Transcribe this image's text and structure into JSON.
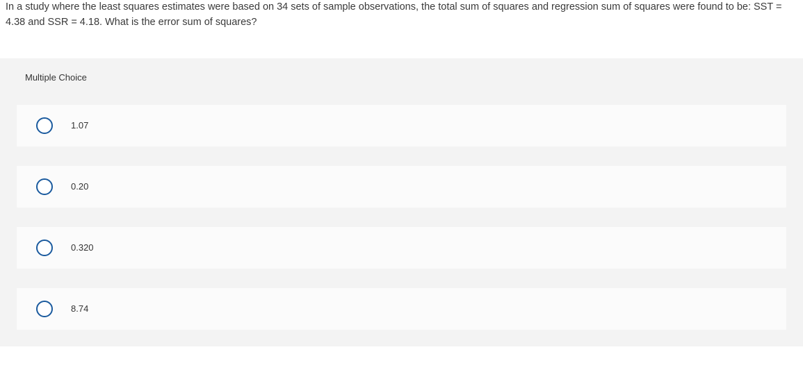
{
  "question": "In a study where the least squares estimates were based on 34 sets of sample observations, the total sum of squares and regression sum of squares were found to be: SST = 4.38 and SSR = 4.18. What is the error sum of squares?",
  "section_label": "Multiple Choice",
  "choices": [
    {
      "label": "1.07"
    },
    {
      "label": "0.20"
    },
    {
      "label": "0.320"
    },
    {
      "label": "8.74"
    }
  ]
}
